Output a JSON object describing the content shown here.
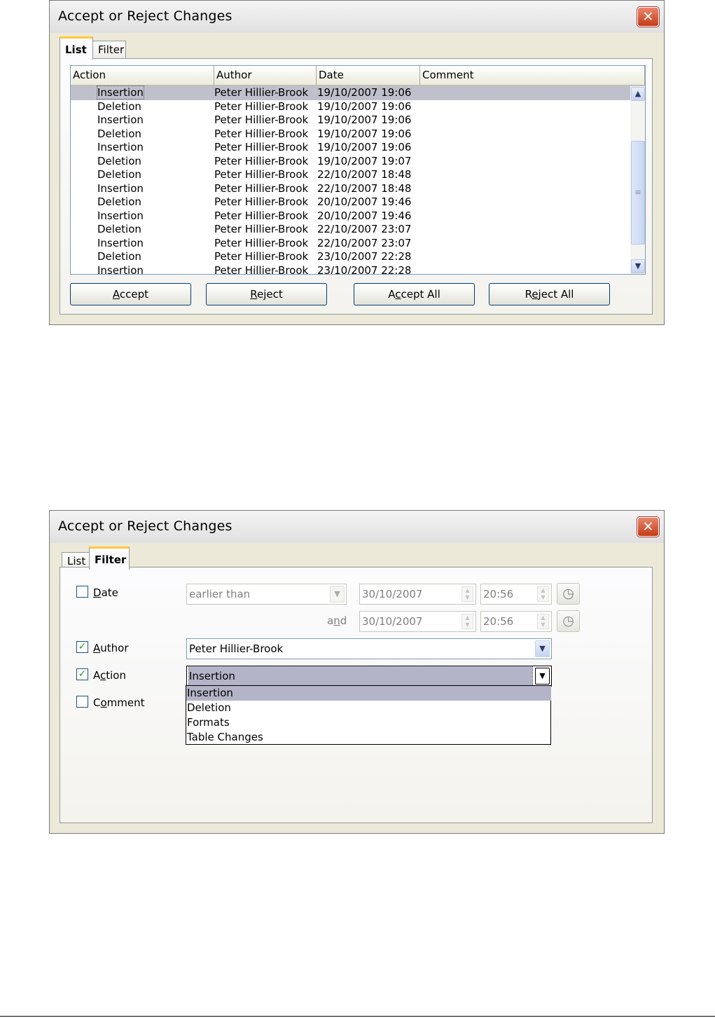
{
  "dialog1": {
    "title": "Accept or Reject Changes",
    "tabs": [
      "List",
      "Filter"
    ],
    "columns": [
      "Action",
      "Author",
      "Date",
      "Comment"
    ],
    "rows": [
      {
        "action": "Insertion",
        "author": "Peter Hillier-Brook",
        "date": "19/10/2007 19:06",
        "comment": ""
      },
      {
        "action": "Deletion",
        "author": "Peter Hillier-Brook",
        "date": "19/10/2007 19:06",
        "comment": ""
      },
      {
        "action": "Insertion",
        "author": "Peter Hillier-Brook",
        "date": "19/10/2007 19:06",
        "comment": ""
      },
      {
        "action": "Deletion",
        "author": "Peter Hillier-Brook",
        "date": "19/10/2007 19:06",
        "comment": ""
      },
      {
        "action": "Insertion",
        "author": "Peter Hillier-Brook",
        "date": "19/10/2007 19:06",
        "comment": ""
      },
      {
        "action": "Deletion",
        "author": "Peter Hillier-Brook",
        "date": "19/10/2007 19:07",
        "comment": ""
      },
      {
        "action": "Deletion",
        "author": "Peter Hillier-Brook",
        "date": "22/10/2007 18:48",
        "comment": ""
      },
      {
        "action": "Insertion",
        "author": "Peter Hillier-Brook",
        "date": "22/10/2007 18:48",
        "comment": ""
      },
      {
        "action": "Deletion",
        "author": "Peter Hillier-Brook",
        "date": "20/10/2007 19:46",
        "comment": ""
      },
      {
        "action": "Insertion",
        "author": "Peter Hillier-Brook",
        "date": "20/10/2007 19:46",
        "comment": ""
      },
      {
        "action": "Deletion",
        "author": "Peter Hillier-Brook",
        "date": "22/10/2007 23:07",
        "comment": ""
      },
      {
        "action": "Insertion",
        "author": "Peter Hillier-Brook",
        "date": "22/10/2007 23:07",
        "comment": ""
      },
      {
        "action": "Deletion",
        "author": "Peter Hillier-Brook",
        "date": "23/10/2007 22:28",
        "comment": ""
      },
      {
        "action": "Insertion",
        "author": "Peter Hillier-Brook",
        "date": "23/10/2007 22:28",
        "comment": ""
      }
    ],
    "selected_row": 0,
    "buttons": {
      "accept": {
        "pre": "",
        "key": "A",
        "post": "ccept"
      },
      "reject": {
        "pre": "",
        "key": "R",
        "post": "eject"
      },
      "accept_all": {
        "pre": "A",
        "key": "c",
        "post": "cept All"
      },
      "reject_all": {
        "pre": "R",
        "key": "e",
        "post": "ject All"
      }
    }
  },
  "dialog2": {
    "title": "Accept or Reject Changes",
    "tabs": [
      "List",
      "Filter"
    ],
    "date": {
      "label_key": "D",
      "label_rest": "ate",
      "checked": false,
      "condition": "earlier than",
      "date1": "30/10/2007",
      "time1": "20:56",
      "and_label_pre": "a",
      "and_label_key": "n",
      "and_label_post": "d",
      "date2": "30/10/2007",
      "time2": "20:56"
    },
    "author": {
      "label_key": "A",
      "label_rest": "uthor",
      "checked": true,
      "value": "Peter Hillier-Brook"
    },
    "action": {
      "label_pre": "A",
      "label_key": "c",
      "label_post": "tion",
      "checked": true,
      "value": "Insertion",
      "options": [
        "Insertion",
        "Deletion",
        "Formats",
        "Table Changes"
      ],
      "highlighted_option": 0
    },
    "comment": {
      "label_pre": "C",
      "label_key": "o",
      "label_post": "mment",
      "checked": false
    }
  },
  "icons": {
    "close": "close-icon",
    "check": "checkmark-icon",
    "clock": "clock-icon",
    "dropdown": "chevron-down-icon"
  }
}
